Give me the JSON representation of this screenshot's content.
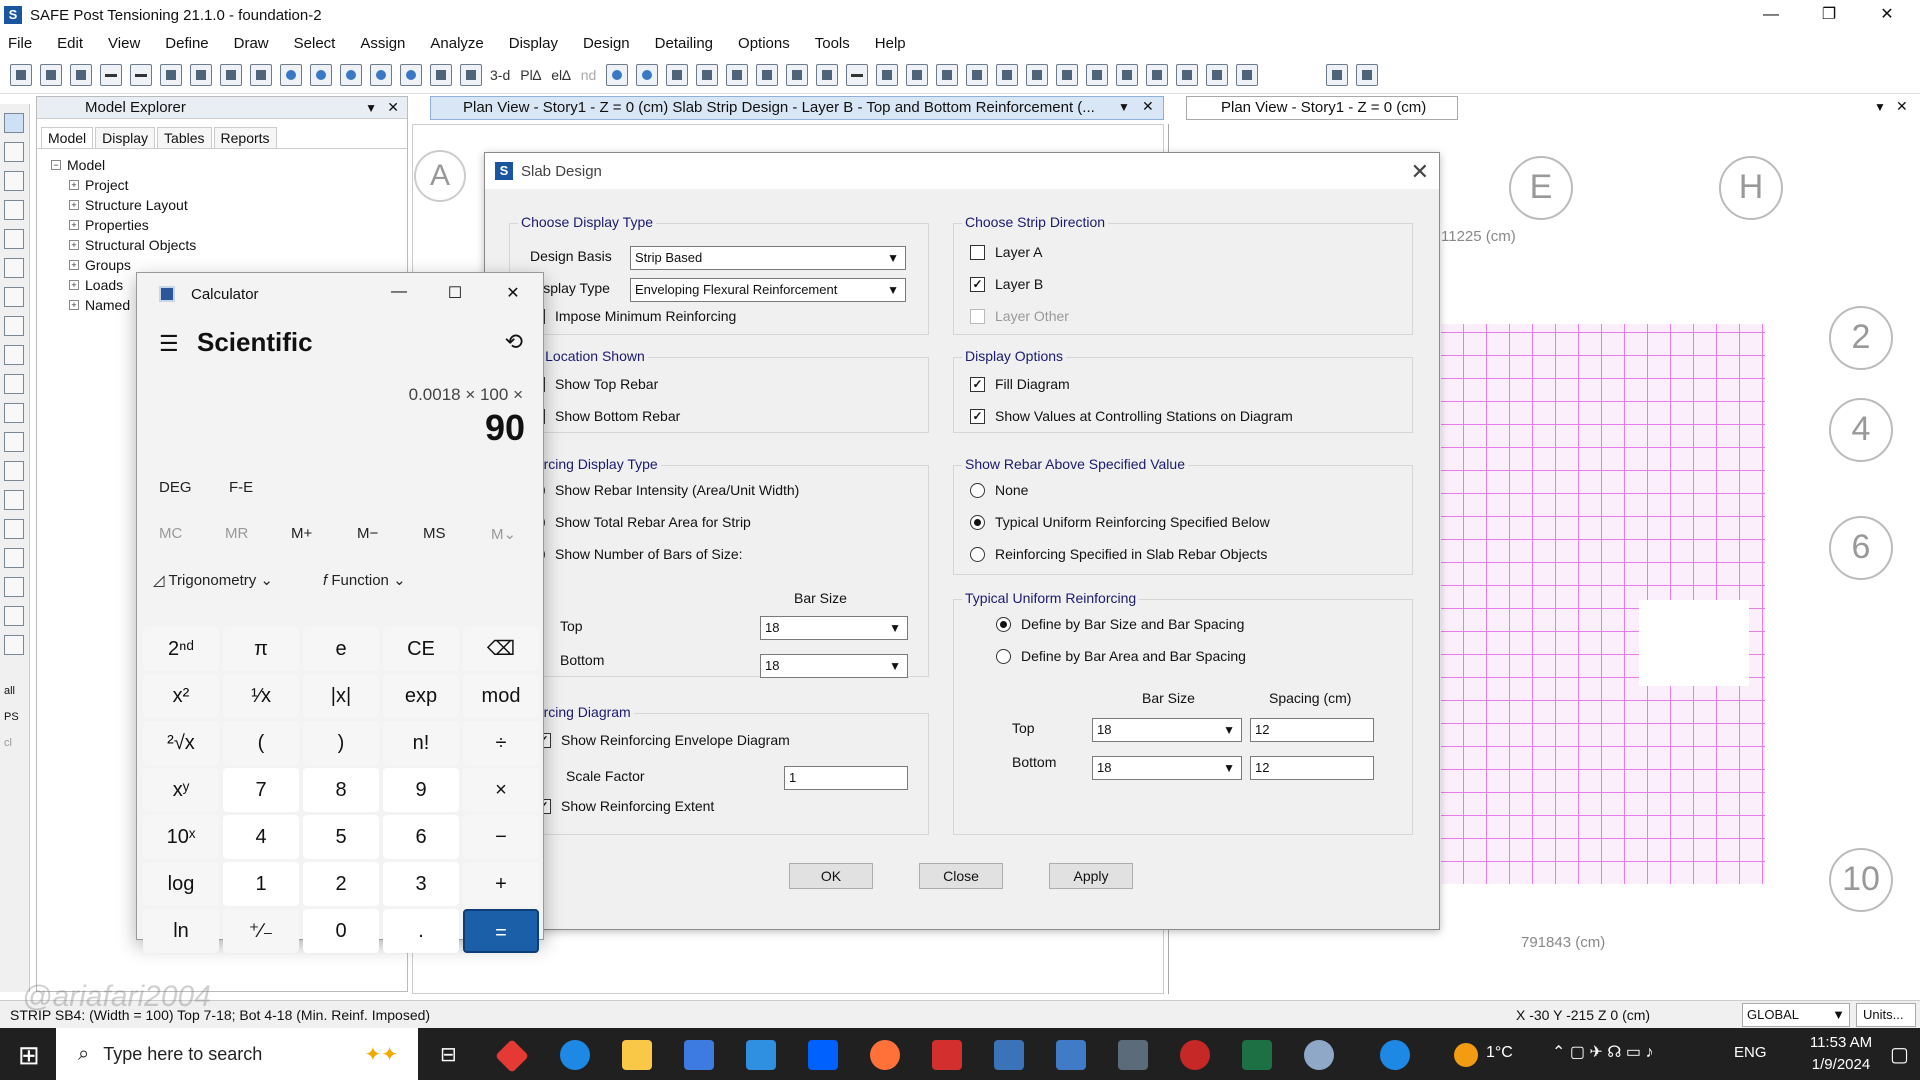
{
  "window": {
    "title": "SAFE Post Tensioning 21.1.0 - foundation-2",
    "logo_letter": "S",
    "minimize": "—",
    "maximize": "❐",
    "close": "✕"
  },
  "menu": [
    "File",
    "Edit",
    "View",
    "Define",
    "Draw",
    "Select",
    "Assign",
    "Analyze",
    "Display",
    "Design",
    "Detailing",
    "Options",
    "Tools",
    "Help"
  ],
  "toolbar": {
    "text_3d": "3-d",
    "text_pla": "Pl∆",
    "text_ele": "el∆",
    "text_nd": "nd"
  },
  "model_explorer": {
    "title": "Model Explorer",
    "tabs": [
      "Model",
      "Display",
      "Tables",
      "Reports"
    ],
    "tree_root": "Model",
    "tree_items": [
      "Project",
      "Structure Layout",
      "Properties",
      "Structural Objects",
      "Groups",
      "Loads",
      "Named"
    ]
  },
  "center_tab": "Plan View - Story1 - Z = 0 (cm)  Slab Strip Design - Layer B - Top and Bottom Reinforcement (...",
  "right_tab": "Plan View - Story1 - Z = 0 (cm)",
  "drawing": {
    "bubbles": [
      "E",
      "H",
      "2",
      "4",
      "6",
      "10"
    ],
    "dim_top": "11225 (cm)",
    "dim_bottom": "791843 (cm)",
    "center_letter": "A"
  },
  "slab_design": {
    "title": "Slab Design",
    "display_type_group": "Choose Display Type",
    "design_basis_label": "Design Basis",
    "design_basis_value": "Strip Based",
    "display_type_label": "Display Type",
    "display_type_value": "Enveloping Flexural Reinforcement",
    "impose_min": "Impose Minimum Reinforcing",
    "strip_dir_group": "Choose Strip Direction",
    "layer_a": "Layer A",
    "layer_b": "Layer B",
    "layer_other": "Layer Other",
    "rebar_loc_group": "bar Location Shown",
    "show_top": "Show Top Rebar",
    "show_bottom": "Show Bottom Rebar",
    "display_opts_group": "Display Options",
    "fill_diagram": "Fill Diagram",
    "show_values": "Show Values at Controlling Stations on Diagram",
    "reinf_display_group": "inforcing Display Type",
    "intensity": "Show Rebar Intensity (Area/Unit Width)",
    "total_area": "Show Total Rebar Area for Strip",
    "num_bars": "Show Number of Bars of Size:",
    "bar_size_hdr": "Bar Size",
    "top_label": "Top",
    "bottom_label": "Bottom",
    "top_size": "18",
    "bottom_size": "18",
    "above_group": "Show Rebar Above Specified Value",
    "none": "None",
    "typical_uniform": "Typical Uniform Reinforcing Specified Below",
    "slab_objects": "Reinforcing Specified in Slab Rebar Objects",
    "typical_group": "Typical Uniform Reinforcing",
    "define_size_spacing": "Define by Bar Size and Bar Spacing",
    "define_area_spacing": "Define by Bar Area and Bar Spacing",
    "bar_size_hdr2": "Bar Size",
    "spacing_hdr": "Spacing  (cm)",
    "t_top_size": "18",
    "t_top_spacing": "12",
    "t_bot_size": "18",
    "t_bot_spacing": "12",
    "diagram_group": "inforcing Diagram",
    "show_envelope": "Show Reinforcing Envelope Diagram",
    "scale_factor_label": "Scale Factor",
    "scale_factor": "1",
    "show_extent": "Show Reinforcing Extent",
    "ok": "OK",
    "close": "Close",
    "apply": "Apply"
  },
  "calculator": {
    "title": "Calculator",
    "mode": "Scientific",
    "expression": "0.0018 × 100 ×",
    "result": "90",
    "deg": "DEG",
    "fe": "F-E",
    "memory": [
      "MC",
      "MR",
      "M+",
      "M−",
      "MS",
      "M⌄"
    ],
    "trig": "Trigonometry",
    "function": "Function",
    "keys": [
      [
        "2ⁿᵈ",
        "π",
        "e",
        "CE",
        "⌫"
      ],
      [
        "x²",
        "¹∕x",
        "|x|",
        "exp",
        "mod"
      ],
      [
        "²√x",
        "(",
        ")",
        "n!",
        "÷"
      ],
      [
        "xʸ",
        "7",
        "8",
        "9",
        "×"
      ],
      [
        "10ˣ",
        "4",
        "5",
        "6",
        "−"
      ],
      [
        "log",
        "1",
        "2",
        "3",
        "+"
      ],
      [
        "ln",
        "⁺∕₋",
        "0",
        ".",
        "="
      ]
    ]
  },
  "status": {
    "left": "STRIP SB4: (Width = 100) Top 7-18; Bot 4-18 (Min. Reinf. Imposed)",
    "coords": "X -30  Y -215  Z 0 (cm)",
    "system": "GLOBAL",
    "units": "Units...",
    "left_all": "all",
    "left_ps": "PS",
    "left_cl": "cl"
  },
  "taskbar": {
    "search": "Type here to search",
    "temp": "1°C",
    "lang": "ENG",
    "time": "11:53 AM",
    "date": "1/9/2024"
  },
  "watermark": "@ariafari2004"
}
